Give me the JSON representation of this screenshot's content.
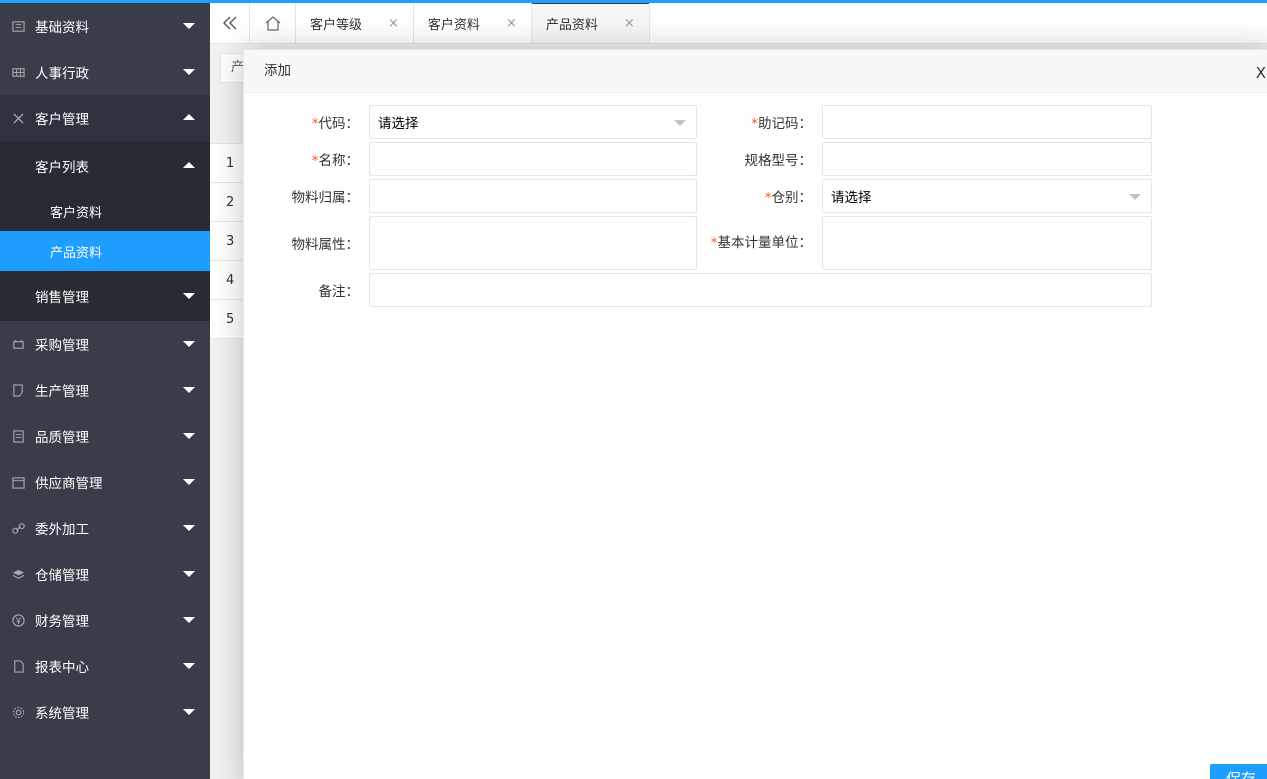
{
  "sidebar": {
    "items": [
      {
        "label": "基础资料",
        "icon": "profile-icon"
      },
      {
        "label": "人事行政",
        "icon": "grid-icon"
      },
      {
        "label": "客户管理",
        "icon": "customer-icon",
        "expanded": true
      },
      {
        "label": "采购管理",
        "icon": "cart-icon"
      },
      {
        "label": "生产管理",
        "icon": "note-icon"
      },
      {
        "label": "品质管理",
        "icon": "clipboard-icon"
      },
      {
        "label": "供应商管理",
        "icon": "calendar-icon"
      },
      {
        "label": "委外加工",
        "icon": "link-icon"
      },
      {
        "label": "仓储管理",
        "icon": "layers-icon"
      },
      {
        "label": "财务管理",
        "icon": "yen-icon"
      },
      {
        "label": "报表中心",
        "icon": "file-icon"
      },
      {
        "label": "系统管理",
        "icon": "gear-icon"
      }
    ],
    "customer_sub": {
      "group_label": "客户列表",
      "children": [
        "客户资料",
        "产品资料"
      ],
      "active_child": "产品资料",
      "sales_label": "销售管理"
    }
  },
  "tabs": {
    "items": [
      {
        "label": "客户等级"
      },
      {
        "label": "客户资料"
      },
      {
        "label": "产品资料",
        "active": true
      }
    ],
    "close_glyph": "×"
  },
  "background": {
    "search_text": "产",
    "row_numbers": [
      "1",
      "2",
      "3",
      "4",
      "5"
    ]
  },
  "modal": {
    "title": "添加",
    "close_glyph": "X",
    "fields": {
      "code": {
        "label": "代码：",
        "required": true,
        "value": "请选择"
      },
      "mnemonic": {
        "label": "助记码：",
        "required": true,
        "value": ""
      },
      "name": {
        "label": "名称：",
        "required": true,
        "value": ""
      },
      "spec": {
        "label": "规格型号：",
        "required": false,
        "value": ""
      },
      "owner": {
        "label": "物料归属：",
        "required": false,
        "value": ""
      },
      "warehouse": {
        "label": "仓别：",
        "required": true,
        "value": "请选择"
      },
      "attribute": {
        "label": "物料属性：",
        "required": false,
        "value": ""
      },
      "unit": {
        "label": "基本计量单位：",
        "required": true,
        "value": ""
      },
      "remark": {
        "label": "备注：",
        "required": false,
        "value": ""
      }
    },
    "save_label": "保存"
  },
  "colors": {
    "sidebar_bg": "#393d49",
    "submenu_bg": "#282b33",
    "accent": "#1e9fff",
    "required": "#ff5722"
  }
}
